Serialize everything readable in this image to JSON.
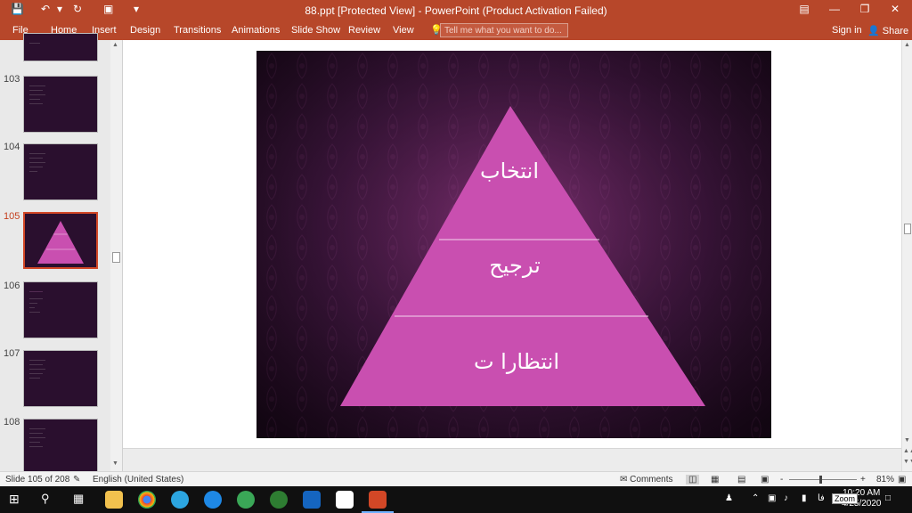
{
  "window": {
    "title": "88.ppt [Protected View] - PowerPoint (Product Activation Failed)",
    "quick_access": {
      "save_icon": "save-icon",
      "undo_icon": "undo-icon",
      "redo_icon": "redo-icon",
      "present_icon": "present-icon",
      "customize_icon": "dropdown-icon"
    },
    "controls": {
      "restore_ribbon": "ribbon-display-icon",
      "minimize": "minimize-icon",
      "maximize": "restore-icon",
      "close": "close-icon"
    }
  },
  "ribbon": {
    "tabs": [
      "File",
      "Home",
      "Insert",
      "Design",
      "Transitions",
      "Animations",
      "Slide Show",
      "Review",
      "View"
    ],
    "tell_me_placeholder": "Tell me what you want to do...",
    "sign_in": "Sign in",
    "share": "Share"
  },
  "thumbnails": {
    "items": [
      {
        "number": "103",
        "active": false
      },
      {
        "number": "104",
        "active": false
      },
      {
        "number": "105",
        "active": true
      },
      {
        "number": "106",
        "active": false
      },
      {
        "number": "107",
        "active": false
      },
      {
        "number": "108",
        "active": false
      }
    ]
  },
  "slide": {
    "pyramid": {
      "levels": [
        "انتخاب",
        "ترجیح",
        "انتظارا ت"
      ],
      "fill": "#c94fb0",
      "divider": "#f3d6ec"
    }
  },
  "status": {
    "slide_counter": "Slide 105 of 208",
    "language": "English (United States)",
    "comments": "Comments",
    "zoom_minus": "-",
    "zoom_plus": "+",
    "zoom_percent": "81%",
    "zoom_level": 0.45
  },
  "taskbar": {
    "time": "10:20 AM",
    "date": "4/25/2020",
    "lang": "فا",
    "zoom_tooltip": "Zoom"
  },
  "colors": {
    "accent": "#b7472a",
    "active_thumb": "#d24726"
  }
}
